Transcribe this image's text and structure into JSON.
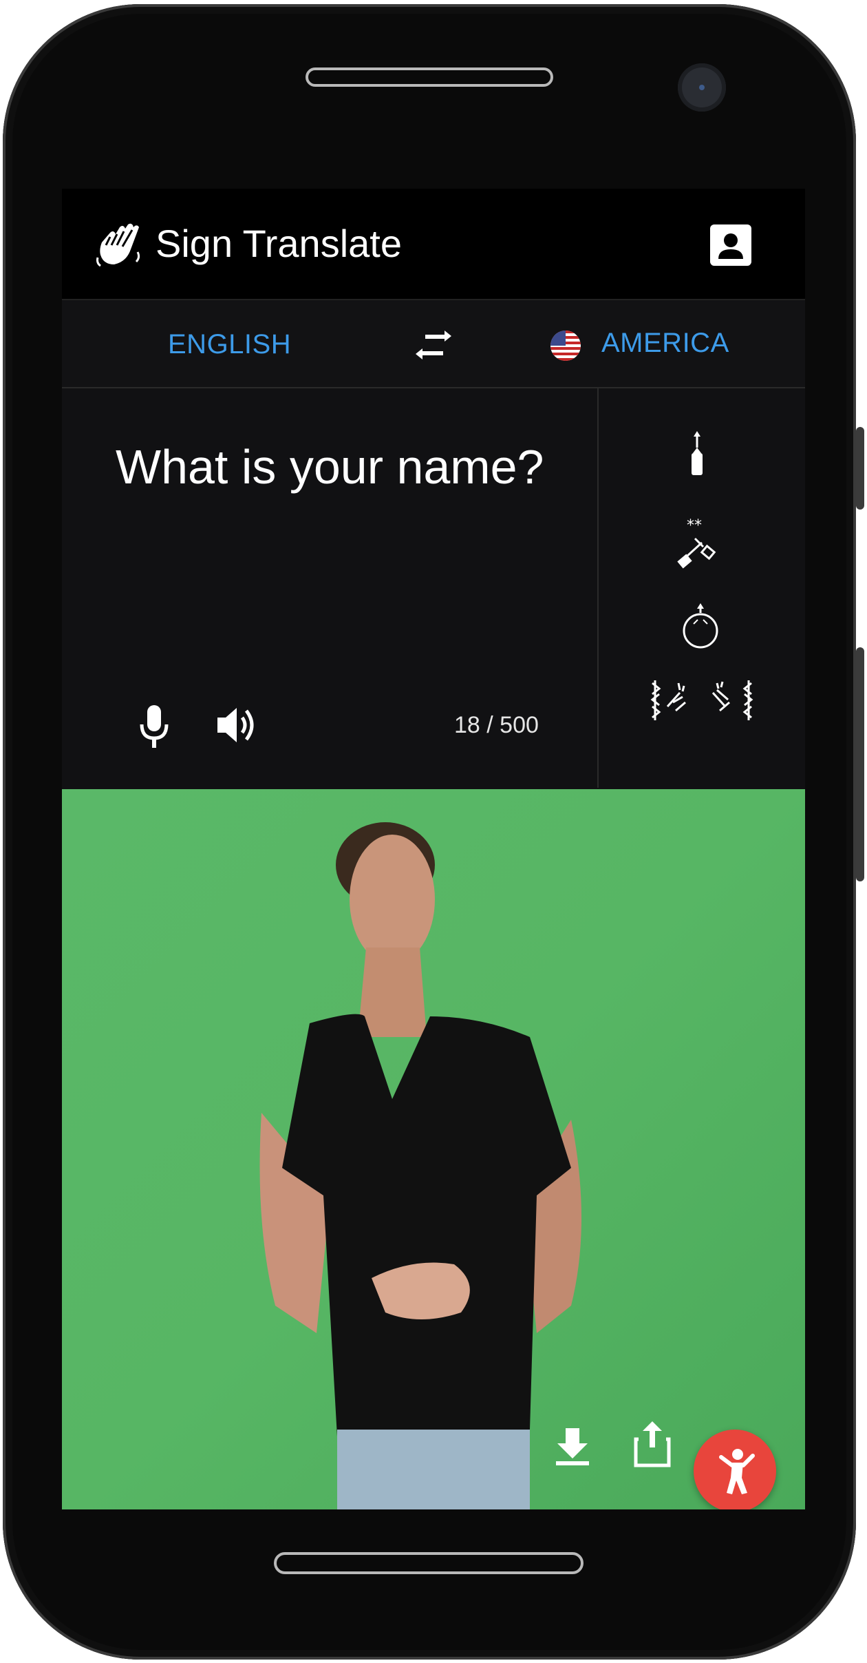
{
  "app": {
    "title": "Sign Translate"
  },
  "languages": {
    "source_label": "ENGLISH",
    "target_label": "AMERICA"
  },
  "input": {
    "text": "What is your name?",
    "counter": "18 / 500"
  },
  "icons": {
    "logo": "waving-hand-icon",
    "account": "account-box-icon",
    "swap": "swap-horiz-icon",
    "flag": "us-flag-icon",
    "mic": "microphone-icon",
    "speaker": "volume-up-icon",
    "download": "download-icon",
    "share": "share-icon",
    "fab": "accessibility-person-icon"
  },
  "colors": {
    "accent": "#3d9be9",
    "fab": "#e8453c",
    "greenscreen": "#57b664"
  }
}
